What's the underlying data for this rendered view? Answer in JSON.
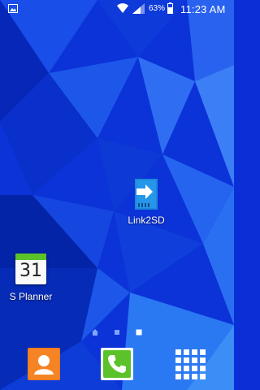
{
  "status_bar": {
    "notification_icon": "gallery-icon",
    "wifi_icon": "wifi-icon",
    "signal_icon": "signal-icon",
    "battery_percent": "63%",
    "battery_icon": "battery-icon",
    "time": "11:23 AM"
  },
  "home_apps": [
    {
      "label": "Link2SD",
      "icon": "link2sd-sd-card-icon"
    },
    {
      "label": "S Planner",
      "icon": "calendar-icon",
      "calendar_day": "31"
    }
  ],
  "page_indicator": {
    "pages": 3,
    "current_page": 3,
    "first_page_icon": "home-icon"
  },
  "dock": [
    {
      "icon": "contacts-icon"
    },
    {
      "icon": "phone-icon"
    },
    {
      "icon": "apps-grid-icon"
    }
  ],
  "colors": {
    "wallpaper_base": "#0a2fd6",
    "contacts_orange": "#f2761e",
    "phone_green": "#5cc229",
    "link2sd_blue": "#1f8fe0"
  }
}
